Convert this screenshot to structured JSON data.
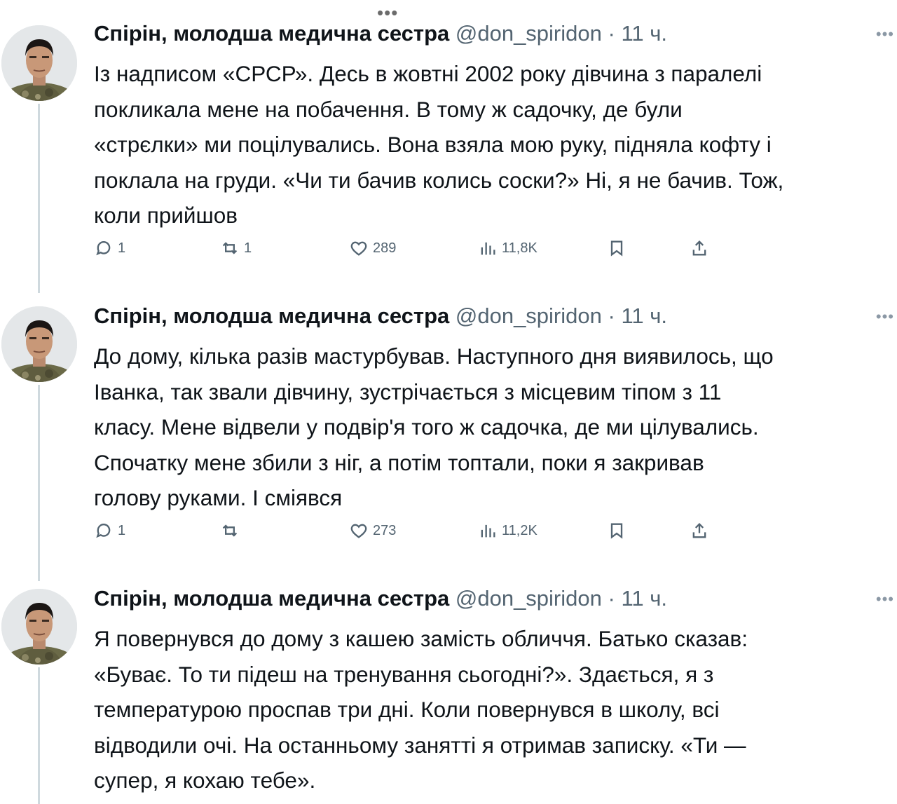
{
  "top_more": "•••",
  "tweets": [
    {
      "author_name": "Спірін, молодша медична сестра",
      "author_handle": "@don_spiridon",
      "separator": "·",
      "time": "11 ч.",
      "lines": [
        "Із надписом «СРСР». Десь в жовтні 2002 року дівчина з паралелі",
        "покликала мене на побачення. В тому ж садочку, де були",
        "«стрєлки» ми поцілувались. Вона взяла мою руку, підняла кофту і",
        "поклала на груди. «Чи ти бачив колись соски?» Ні, я не бачив. Тож,",
        "коли прийшов"
      ],
      "replies": "1",
      "reposts": "1",
      "likes": "289",
      "views": "11,8K"
    },
    {
      "author_name": "Спірін, молодша медична сестра",
      "author_handle": "@don_spiridon",
      "separator": "·",
      "time": "11 ч.",
      "lines": [
        "До дому, кілька разів мастурбував. Наступного дня виявилось, що",
        "Іванка, так звали дівчину, зустрічається з місцевим тіпом з 11",
        "класу. Мене відвели у подвір'я того ж садочка, де ми цілувались.",
        "Спочатку мене збили  з ніг, а потім топтали, поки я закривав",
        "голову руками. І сміявся"
      ],
      "replies": "1",
      "reposts": "",
      "likes": "273",
      "views": "11,2K"
    },
    {
      "author_name": "Спірін, молодша медична сестра",
      "author_handle": "@don_spiridon",
      "separator": "·",
      "time": "11 ч.",
      "lines": [
        "Я повернувся до дому з кашею замість обличчя. Батько сказав:",
        "«Буває. То ти підеш на тренування сьогодні?». Здається, я з",
        "температурою проспав три дні. Коли повернувся в школу, всі",
        "відводили очі. На останньому занятті я отримав записку. «Ти —",
        "супер, я кохаю тебе»."
      ]
    }
  ]
}
